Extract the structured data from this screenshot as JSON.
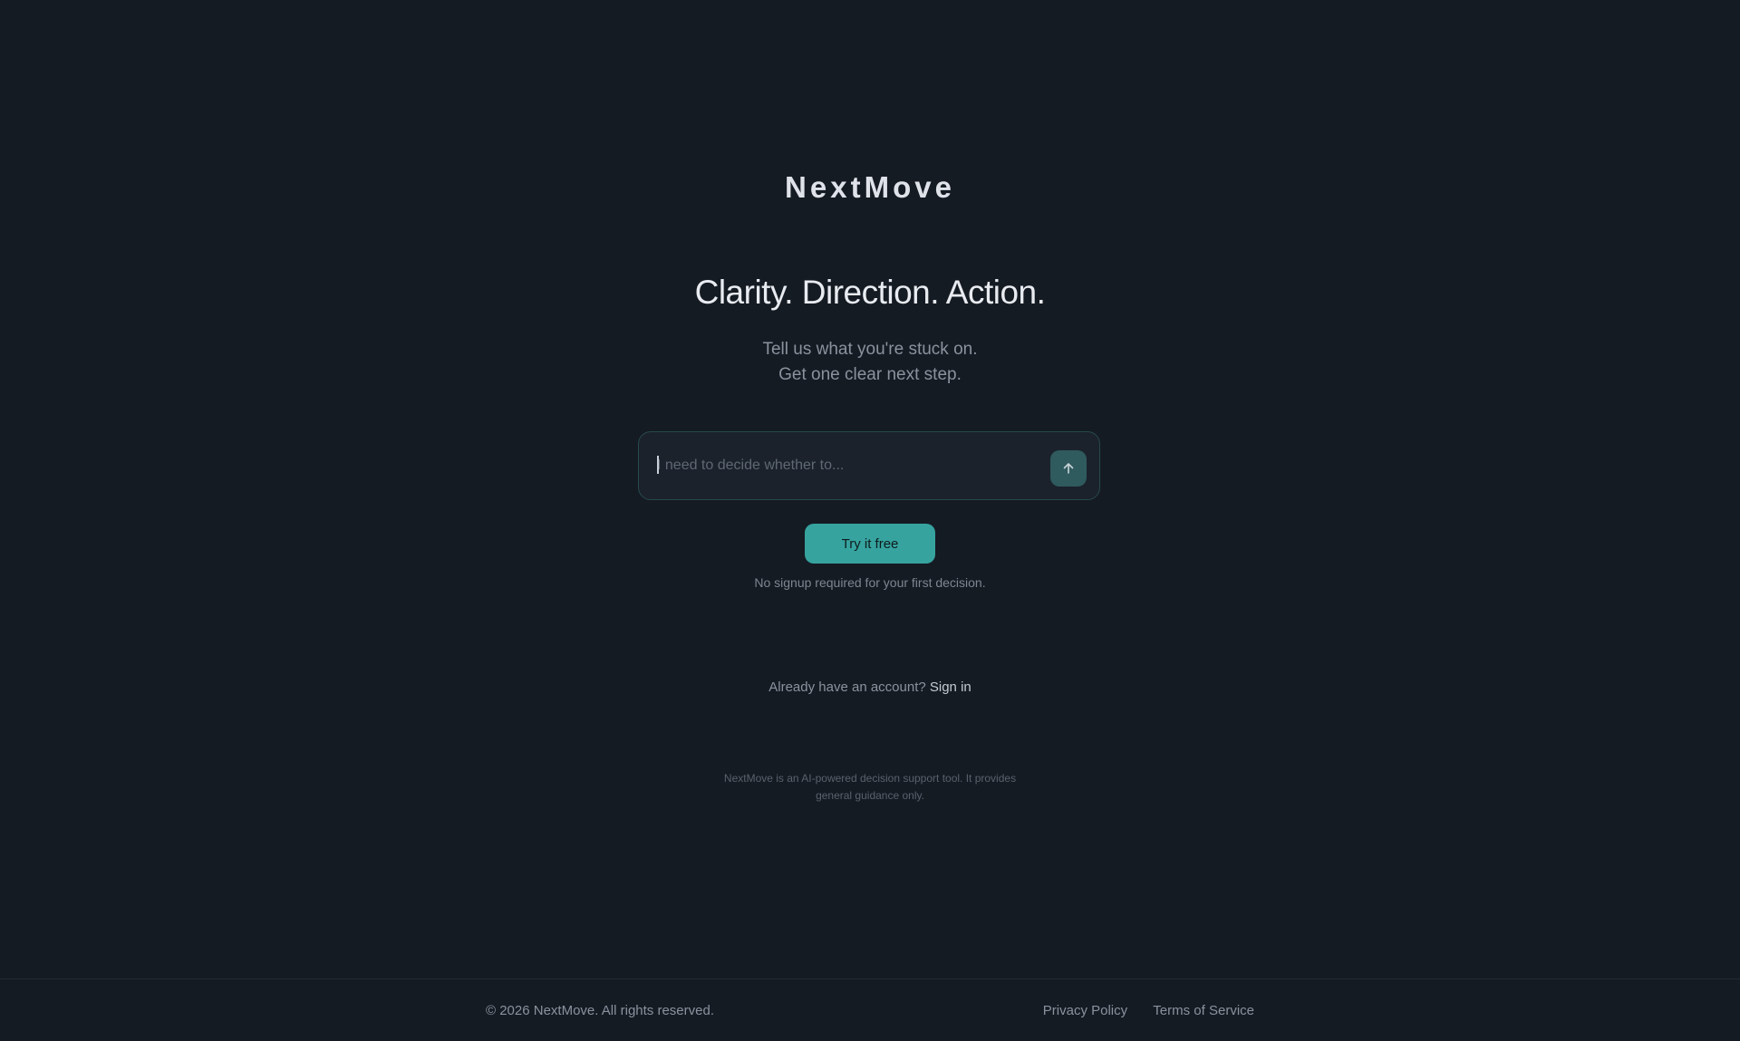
{
  "brand": {
    "name": "NextMove"
  },
  "hero": {
    "headline": "Clarity. Direction. Action.",
    "subline_1": "Tell us what you're stuck on.",
    "subline_2": "Get one clear next step."
  },
  "prompt": {
    "placeholder": "I need to decide whether to...",
    "value": "",
    "send_icon": "arrow-up-icon"
  },
  "cta": {
    "label": "Try it free",
    "note": "No signup required for your first decision."
  },
  "account": {
    "question": "Already have an account?",
    "signin_label": "Sign in"
  },
  "disclaimer": {
    "line_1": "NextMove is an AI-powered decision support tool. It provides",
    "line_2": "general guidance only."
  },
  "footer": {
    "copyright": "© 2026 NextMove. All rights reserved.",
    "links": [
      "Privacy Policy",
      "Terms of Service"
    ]
  },
  "colors": {
    "background": "#151b23",
    "accent": "#36a39f",
    "send_button": "#2f5a5e"
  }
}
